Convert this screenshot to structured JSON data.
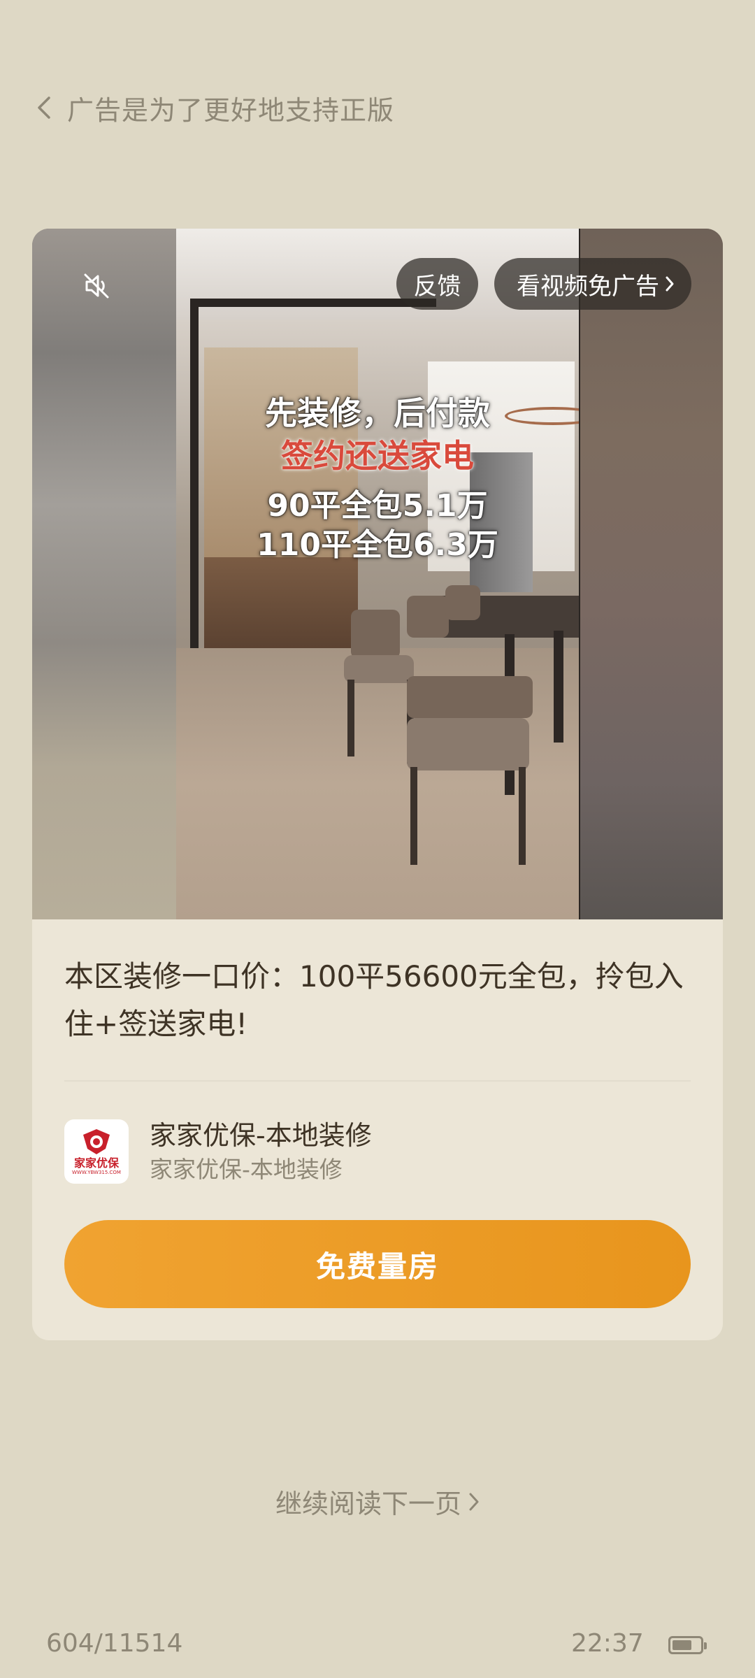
{
  "header": {
    "title": "广告是为了更好地支持正版",
    "back_icon": "chevron-left-icon"
  },
  "ad": {
    "mute_icon": "volume-mute-icon",
    "feedback_label": "反馈",
    "watch_video_label": "看视频免广告",
    "overlay_line1": "先装修，后付款",
    "overlay_line2": "签约还送家电",
    "overlay_line3": "90平全包5.1万",
    "overlay_line4": "110平全包6.3万",
    "overlay_highlight_color": "#d94a3c",
    "headline": "本区装修一口价：100平56600元全包，拎包入住+签送家电!",
    "advertiser_name": "家家优保-本地装修",
    "advertiser_sub": "家家优保-本地装修",
    "logo_text": "家家优保",
    "logo_url": "WWW.YBW315.COM",
    "cta_label": "免费量房",
    "cta_color": "#ee9d27"
  },
  "footer": {
    "continue_label": "继续阅读下一页",
    "page_progress": "604/11514",
    "time": "22:37",
    "battery_level": 0.7
  },
  "colors": {
    "background": "#ded8c5",
    "card": "#ece6d7",
    "muted_text": "#8e8776",
    "primary_text": "#3e3325"
  }
}
